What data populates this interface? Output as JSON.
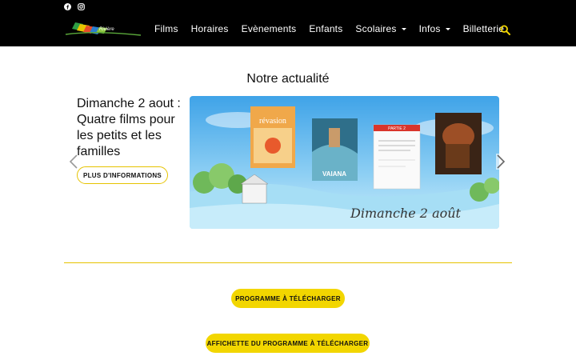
{
  "header": {
    "social": [
      {
        "icon": "facebook-icon"
      },
      {
        "icon": "instagram-icon"
      }
    ],
    "logo_text": "Rivière",
    "nav": [
      {
        "label": "Films",
        "dropdown": false
      },
      {
        "label": "Horaires",
        "dropdown": false
      },
      {
        "label": "Evènements",
        "dropdown": false
      },
      {
        "label": "Enfants",
        "dropdown": false
      },
      {
        "label": "Scolaires",
        "dropdown": true
      },
      {
        "label": "Infos",
        "dropdown": true
      },
      {
        "label": "Billetterie",
        "dropdown": false
      }
    ],
    "search_icon": "search-icon"
  },
  "main": {
    "title": "Notre actualité",
    "slide": {
      "heading": "Dimanche 2 aout : Quatre films pour les petits et les familles",
      "button": "PLUS D'INFORMATIONS",
      "image": {
        "poster_titles": [
          "révasion",
          "VAIANA",
          "PARTIE 2",
          ""
        ],
        "caption": "Dimanche 2 août"
      }
    },
    "buttons": {
      "program": "PROGRAMME À TÉLÉCHARGER",
      "poster": "AFFICHETTE DU PROGRAMME À TÉLÉCHARGER"
    }
  },
  "colors": {
    "accent": "#f2d600",
    "header_bg": "#000000"
  }
}
